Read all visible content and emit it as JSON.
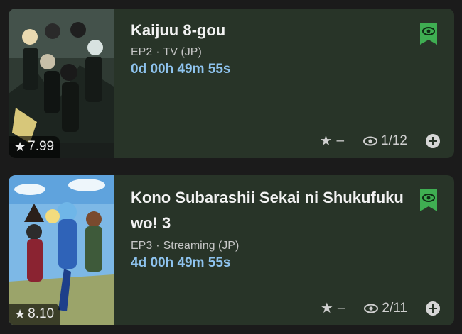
{
  "entries": [
    {
      "title": "Kaijuu 8-gou",
      "episode": "EP2",
      "format": "TV (JP)",
      "separator": "·",
      "countdown": "0d 00h 49m 55s",
      "score": "7.99",
      "user_rating": "–",
      "progress": "1/12",
      "icons": [
        "eye-icon",
        "star-icon",
        "plus-icon"
      ],
      "badge_color": "#3fae52"
    },
    {
      "title": "Kono Subarashii Sekai ni Shukufuku wo! 3",
      "episode": "EP3",
      "format": "Streaming (JP)",
      "separator": "·",
      "countdown": "4d 00h 49m 55s",
      "score": "8.10",
      "user_rating": "–",
      "progress": "2/11",
      "icons": [
        "eye-icon",
        "star-icon",
        "plus-icon"
      ],
      "badge_color": "#3fae52"
    }
  ],
  "colors": {
    "background": "#1b1b1b",
    "card": "#283428",
    "countdown": "#8ec3ee",
    "accent_green": "#3fae52"
  }
}
